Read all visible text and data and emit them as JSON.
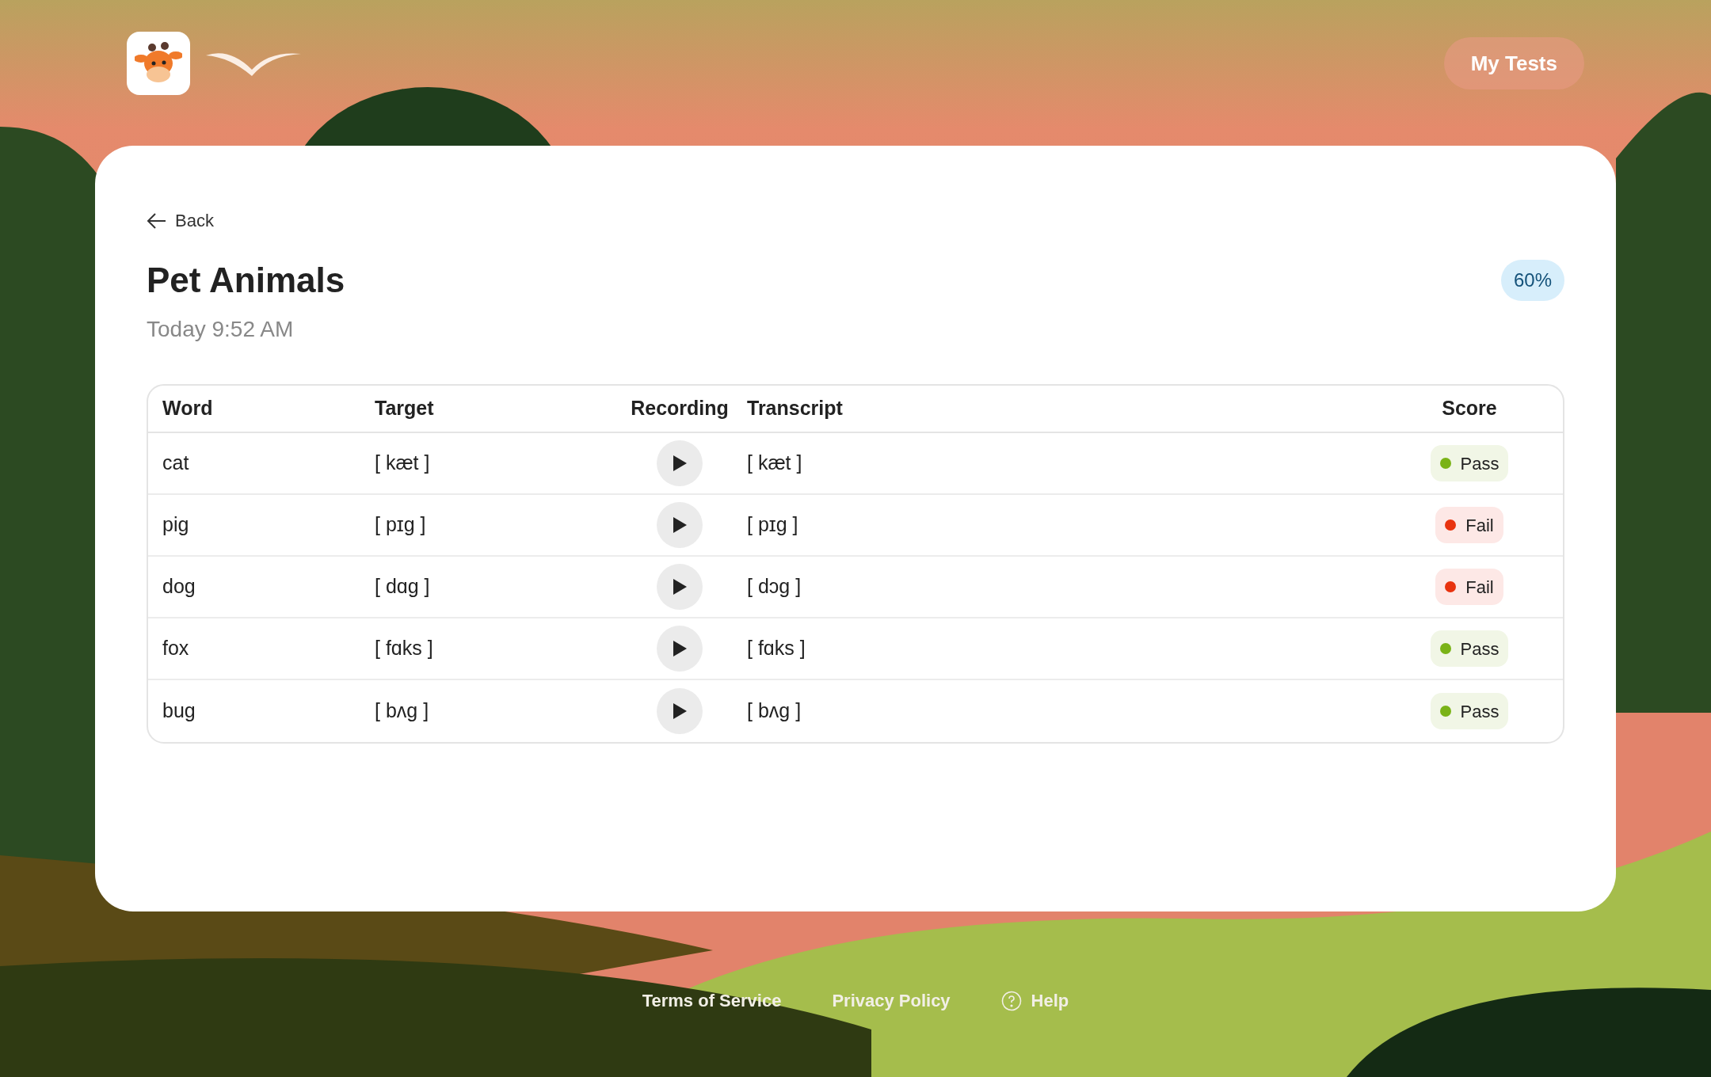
{
  "header": {
    "nav_button": "My Tests"
  },
  "back_link": "Back",
  "title": "Pet Animals",
  "date": "Today 9:52 AM",
  "overall_score": "60%",
  "table": {
    "columns": [
      "Word",
      "Target",
      "Recording",
      "Transcript",
      "Score"
    ],
    "rows": [
      {
        "word": "cat",
        "target": "[ kæt ]",
        "transcript": "[ kæt ]",
        "score": {
          "label": "Pass",
          "kind": "pass",
          "color": "#7ab317"
        }
      },
      {
        "word": "pig",
        "target": "[ pɪg ]",
        "transcript": "[ pɪg ]",
        "score": {
          "label": "Fail",
          "kind": "fail",
          "color": "#e8330f"
        }
      },
      {
        "word": "dog",
        "target": "[ dɑg ]",
        "transcript": "[ dɔg ]",
        "score": {
          "label": "Fail",
          "kind": "fail",
          "color": "#e8330f"
        }
      },
      {
        "word": "fox",
        "target": "[ fɑks ]",
        "transcript": "[ fɑks ]",
        "score": {
          "label": "Pass",
          "kind": "pass",
          "color": "#7ab317"
        }
      },
      {
        "word": "bug",
        "target": "[ bʌg ]",
        "transcript": "[ bʌg ]",
        "score": {
          "label": "Pass",
          "kind": "pass",
          "color": "#7ab317"
        }
      }
    ]
  },
  "footer": {
    "links": [
      "Terms of Service",
      "Privacy Policy"
    ],
    "help": "Help"
  }
}
